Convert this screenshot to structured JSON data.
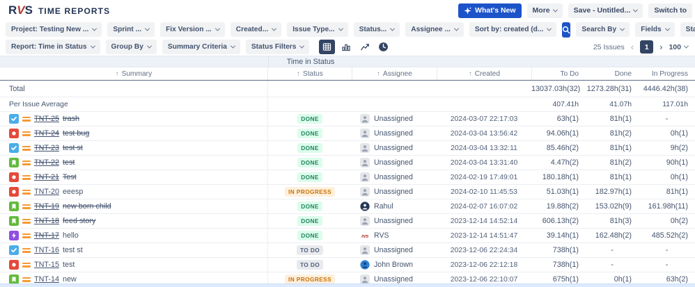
{
  "brand": {
    "mark_r": "R",
    "mark_v": "V",
    "mark_s": "S",
    "title": "Time Reports"
  },
  "topbar": {
    "whats_new": "What's New",
    "more": "More",
    "save": "Save - Untitled...",
    "switch_to": "Switch to"
  },
  "filter_bar": {
    "filters": [
      "Project: Testing New ...",
      "Sprint ...",
      "Fix Version ...",
      "Created...",
      "Issue Type...",
      "Status...",
      "Assignee ...",
      "Sort by: created (d..."
    ],
    "search_by": "Search By",
    "fields": "Fields",
    "statuses": "Statuses"
  },
  "report_bar": {
    "report": "Report: Time in Status",
    "group_by": "Group By",
    "summary_criteria": "Summary Criteria",
    "status_filters": "Status Filters"
  },
  "pagination": {
    "issues_count": "25 Issues",
    "prev_icon": "‹",
    "next_icon": "›",
    "page": "1",
    "page_size": "100"
  },
  "view_title": "Time in Status",
  "table": {
    "sort_arrow": "↑",
    "columns": [
      "Summary",
      "Status",
      "Assignee",
      "Created",
      "To Do",
      "Done",
      "In Progress"
    ],
    "total_row": {
      "label": "Total",
      "to_do": "13037.03h(32)",
      "done": "1273.28h(31)",
      "in_progress": "4446.42h(38)"
    },
    "average_row": {
      "label": "Per Issue Average",
      "to_do": "407.41h",
      "done": "41.07h",
      "in_progress": "117.01h"
    },
    "rows": [
      {
        "key": "TNT-25",
        "summary": "trash",
        "type": "task",
        "priority": "medium",
        "status": "DONE",
        "status_kind": "done",
        "assignee": "Unassigned",
        "avatar": "unassigned",
        "created": "2024-03-07 22:17:03",
        "to_do": "63h(1)",
        "done": "81h(1)",
        "in_progress": "-",
        "key_struck": true,
        "summary_struck": true
      },
      {
        "key": "TNT-24",
        "summary": "test bug",
        "type": "bug",
        "priority": "medium",
        "status": "DONE",
        "status_kind": "done",
        "assignee": "Unassigned",
        "avatar": "unassigned",
        "created": "2024-03-04 13:56:42",
        "to_do": "94.06h(1)",
        "done": "81h(2)",
        "in_progress": "0h(1)",
        "key_struck": true,
        "summary_struck": true
      },
      {
        "key": "TNT-23",
        "summary": "test st",
        "type": "task",
        "priority": "medium",
        "status": "DONE",
        "status_kind": "done",
        "assignee": "Unassigned",
        "avatar": "unassigned",
        "created": "2024-03-04 13:32:11",
        "to_do": "85.46h(2)",
        "done": "81h(1)",
        "in_progress": "9h(2)",
        "key_struck": true,
        "summary_struck": true
      },
      {
        "key": "TNT-22",
        "summary": "test",
        "type": "story",
        "priority": "medium",
        "status": "DONE",
        "status_kind": "done",
        "assignee": "Unassigned",
        "avatar": "unassigned",
        "created": "2024-03-04 13:31:40",
        "to_do": "4.47h(2)",
        "done": "81h(2)",
        "in_progress": "90h(1)",
        "key_struck": true,
        "summary_struck": true
      },
      {
        "key": "TNT-21",
        "summary": "Test",
        "type": "bug",
        "priority": "medium",
        "status": "DONE",
        "status_kind": "done",
        "assignee": "Unassigned",
        "avatar": "unassigned",
        "created": "2024-02-19 17:49:01",
        "to_do": "180.18h(1)",
        "done": "81h(1)",
        "in_progress": "0h(1)",
        "key_struck": true,
        "summary_struck": true
      },
      {
        "key": "TNT-20",
        "summary": "eeesp",
        "type": "bug",
        "priority": "medium",
        "status": "IN PROGRESS",
        "status_kind": "inprogress",
        "assignee": "Unassigned",
        "avatar": "unassigned",
        "created": "2024-02-10 11:45:53",
        "to_do": "51.03h(1)",
        "done": "182.97h(1)",
        "in_progress": "81h(1)",
        "key_struck": false,
        "summary_struck": false
      },
      {
        "key": "TNT-19",
        "summary": "new born child",
        "type": "story",
        "priority": "medium",
        "status": "DONE",
        "status_kind": "done",
        "assignee": "Rahul",
        "avatar": "rahul",
        "created": "2024-02-07 16:07:02",
        "to_do": "19.88h(2)",
        "done": "153.02h(9)",
        "in_progress": "161.98h(11)",
        "key_struck": true,
        "summary_struck": true
      },
      {
        "key": "TNT-18",
        "summary": "feed story",
        "type": "story",
        "priority": "medium",
        "status": "DONE",
        "status_kind": "done",
        "assignee": "Unassigned",
        "avatar": "unassigned",
        "created": "2023-12-14 14:52:14",
        "to_do": "606.13h(2)",
        "done": "81h(3)",
        "in_progress": "0h(2)",
        "key_struck": true,
        "summary_struck": true
      },
      {
        "key": "TNT-17",
        "summary": "hello",
        "type": "epic",
        "priority": "medium",
        "status": "DONE",
        "status_kind": "done",
        "assignee": "RVS",
        "avatar": "rvs",
        "created": "2023-12-14 14:51:47",
        "to_do": "39.14h(1)",
        "done": "162.48h(2)",
        "in_progress": "485.52h(2)",
        "key_struck": true,
        "summary_struck": false
      },
      {
        "key": "TNT-16",
        "summary": "test st",
        "type": "task",
        "priority": "medium",
        "status": "TO DO",
        "status_kind": "todo",
        "assignee": "Unassigned",
        "avatar": "unassigned",
        "created": "2023-12-06 22:24:34",
        "to_do": "738h(1)",
        "done": "-",
        "in_progress": "-",
        "key_struck": false,
        "summary_struck": false
      },
      {
        "key": "TNT-15",
        "summary": "test",
        "type": "bug",
        "priority": "medium",
        "status": "TO DO",
        "status_kind": "todo",
        "assignee": "John Brown",
        "avatar": "john",
        "created": "2023-12-06 22:12:18",
        "to_do": "738h(1)",
        "done": "-",
        "in_progress": "-",
        "key_struck": false,
        "summary_struck": false
      },
      {
        "key": "TNT-14",
        "summary": "new",
        "type": "story",
        "priority": "medium",
        "status": "IN PROGRESS",
        "status_kind": "inprogress",
        "assignee": "Unassigned",
        "avatar": "unassigned",
        "created": "2023-12-06 22:10:07",
        "to_do": "675h(1)",
        "done": "0h(1)",
        "in_progress": "63h(2)",
        "key_struck": false,
        "summary_struck": false
      }
    ]
  },
  "colors": {
    "primary_blue": "#1d53c9",
    "navy": "#344563",
    "done_green": "#1f845a",
    "in_progress_orange": "#c9720a",
    "todo_gray": "#505f79",
    "band_bg": "#edf2f9"
  }
}
